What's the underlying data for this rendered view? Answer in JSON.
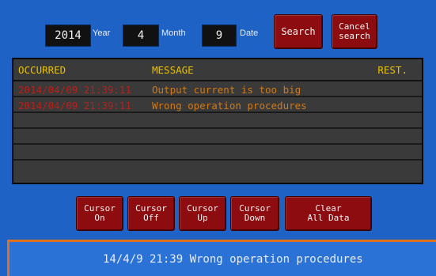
{
  "search": {
    "year_value": "2014",
    "year_label": "Year",
    "month_value": "4",
    "month_label": "Month",
    "date_value": "9",
    "date_label": "Date",
    "search_label": "Search",
    "cancel_label": "Cancel\nsearch"
  },
  "log": {
    "headers": {
      "occurred": "OCCURRED",
      "message": "MESSAGE",
      "rest": "REST."
    },
    "rows": [
      {
        "occurred": "2014/04/09 21:39:11",
        "message": "Output current is too big"
      },
      {
        "occurred": "2014/04/09 21:39:11",
        "message": "Wrong operation procedures"
      },
      {
        "occurred": "",
        "message": ""
      },
      {
        "occurred": "",
        "message": ""
      },
      {
        "occurred": "",
        "message": ""
      },
      {
        "occurred": "",
        "message": ""
      }
    ]
  },
  "controls": {
    "cursor_on": "Cursor\nOn",
    "cursor_off": "Cursor\nOff",
    "cursor_up": "Cursor\nUp",
    "cursor_down": "Cursor\nDown",
    "clear_all": "Clear\nAll Data"
  },
  "status": {
    "text": "14/4/9 21:39 Wrong operation procedures"
  },
  "colors": {
    "background": "#1e62c6",
    "button": "#8c0c10",
    "header_text": "#e9c200",
    "occurred_text": "#b8201a",
    "message_text": "#d07a18",
    "status_border": "#e0701a"
  }
}
